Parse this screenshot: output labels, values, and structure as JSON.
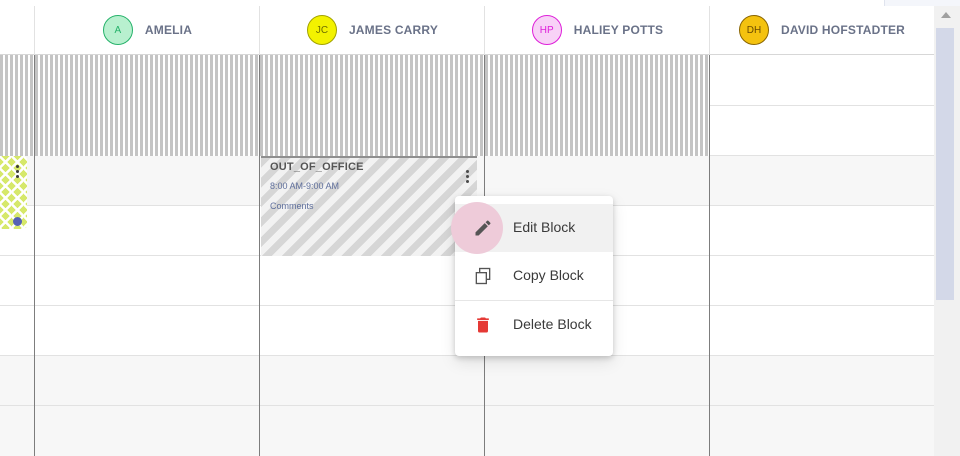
{
  "columns": [
    {
      "initials": "A",
      "name": "AMELIA",
      "avatar_fill": "#b8f0cf",
      "avatar_border": "#25b26a",
      "avatar_text": "#25b26a"
    },
    {
      "initials": "JC",
      "name": "JAMES CARRY",
      "avatar_fill": "#f3f200",
      "avatar_border": "#a2a200",
      "avatar_text": "#6e6e00"
    },
    {
      "initials": "HP",
      "name": "HALIEY POTTS",
      "avatar_fill": "#f8d2f7",
      "avatar_border": "#de1fd9",
      "avatar_text": "#de1fd9"
    },
    {
      "initials": "DH",
      "name": "DAVID HOFSTADTER",
      "avatar_fill": "#f4c20f",
      "avatar_border": "#8a6500",
      "avatar_text": "#6a4a00"
    }
  ],
  "block": {
    "title": "OUT_OF_OFFICE",
    "time": "8:00 AM-9:00 AM",
    "comments": "Comments"
  },
  "context_menu": {
    "items": [
      {
        "label": "Edit Block",
        "icon": "pencil-icon"
      },
      {
        "label": "Copy Block",
        "icon": "copy-icon"
      },
      {
        "label": "Delete Block",
        "icon": "trash-icon"
      }
    ]
  },
  "colors": {
    "accent_delete": "#e53935",
    "edit_ripple": "#eecbd9",
    "chevron_block": "#d6e86a",
    "chevron_marker": "#5561b5"
  }
}
